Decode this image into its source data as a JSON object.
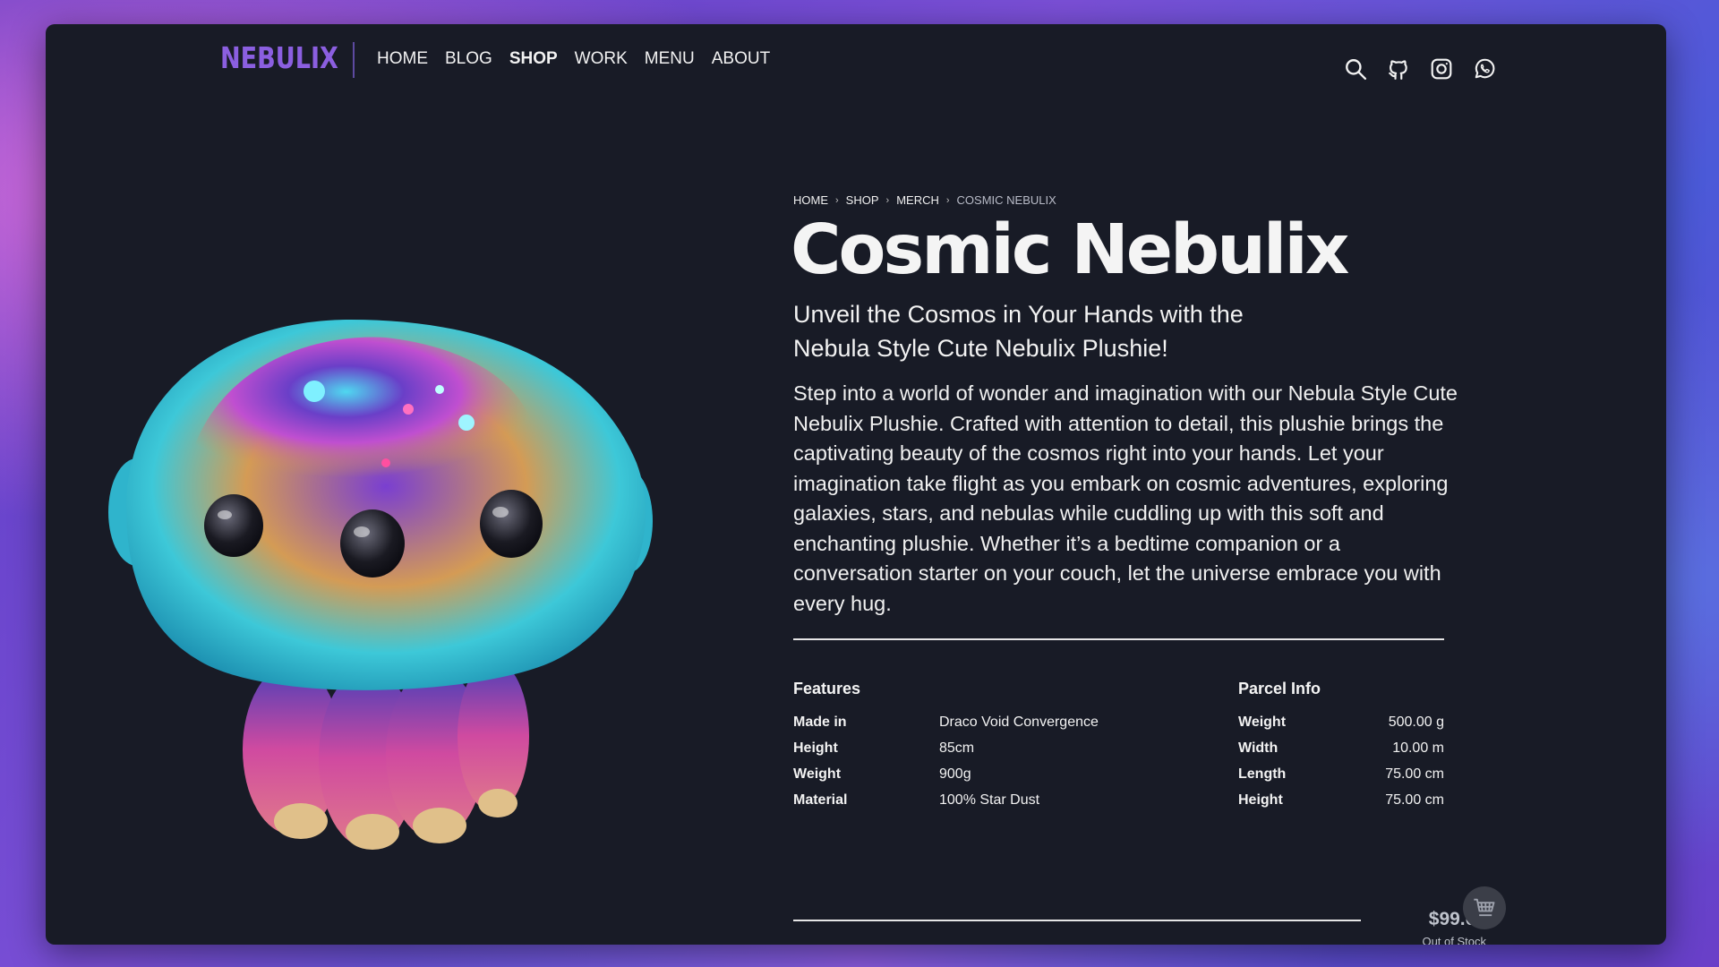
{
  "header": {
    "logo": "NEBULIX",
    "menu": [
      {
        "label": "HOME",
        "active": false
      },
      {
        "label": "BLOG",
        "active": false
      },
      {
        "label": "SHOP",
        "active": true
      },
      {
        "label": "WORK",
        "active": false
      },
      {
        "label": "MENU",
        "active": false
      },
      {
        "label": "ABOUT",
        "active": false
      }
    ],
    "icons": [
      "search-icon",
      "github-icon",
      "instagram-icon",
      "whatsapp-icon"
    ]
  },
  "breadcrumb": {
    "items": [
      "HOME",
      "SHOP",
      "MERCH"
    ],
    "current": "COSMIC NEBULIX",
    "separator": "›"
  },
  "product": {
    "title": "Cosmic Nebulix",
    "subtitle": "Unveil the Cosmos in Your Hands with the Nebula Style Cute Nebulix Plushie!",
    "description": "Step into a world of wonder and imagination with our Nebula Style Cute Nebulix Plushie. Crafted with attention to detail, this plushie brings the captivating beauty of the cosmos right into your hands. Let your imagination take flight as you embark on cosmic adventures, exploring galaxies, stars, and nebulas while cuddling up with this soft and enchanting plushie. Whether it’s a bedtime companion or a conversation starter on your couch, let the universe embrace you with every hug.",
    "price": "$99.00",
    "stock_status": "Out of Stock"
  },
  "features": {
    "title": "Features",
    "rows": [
      {
        "key": "Made in",
        "value": "Draco Void Convergence"
      },
      {
        "key": "Height",
        "value": "85cm"
      },
      {
        "key": "Weight",
        "value": "900g"
      },
      {
        "key": "Material",
        "value": "100% Star Dust"
      }
    ]
  },
  "parcel": {
    "title": "Parcel Info",
    "rows": [
      {
        "key": "Weight",
        "value": "500.00 g"
      },
      {
        "key": "Width",
        "value": "10.00 m"
      },
      {
        "key": "Length",
        "value": "75.00 cm"
      },
      {
        "key": "Height",
        "value": "75.00 cm"
      }
    ]
  },
  "colors": {
    "brand": "#8b5fe0",
    "background": "#181b26",
    "text": "#f2f2f2",
    "muted": "#bfc3cc"
  }
}
